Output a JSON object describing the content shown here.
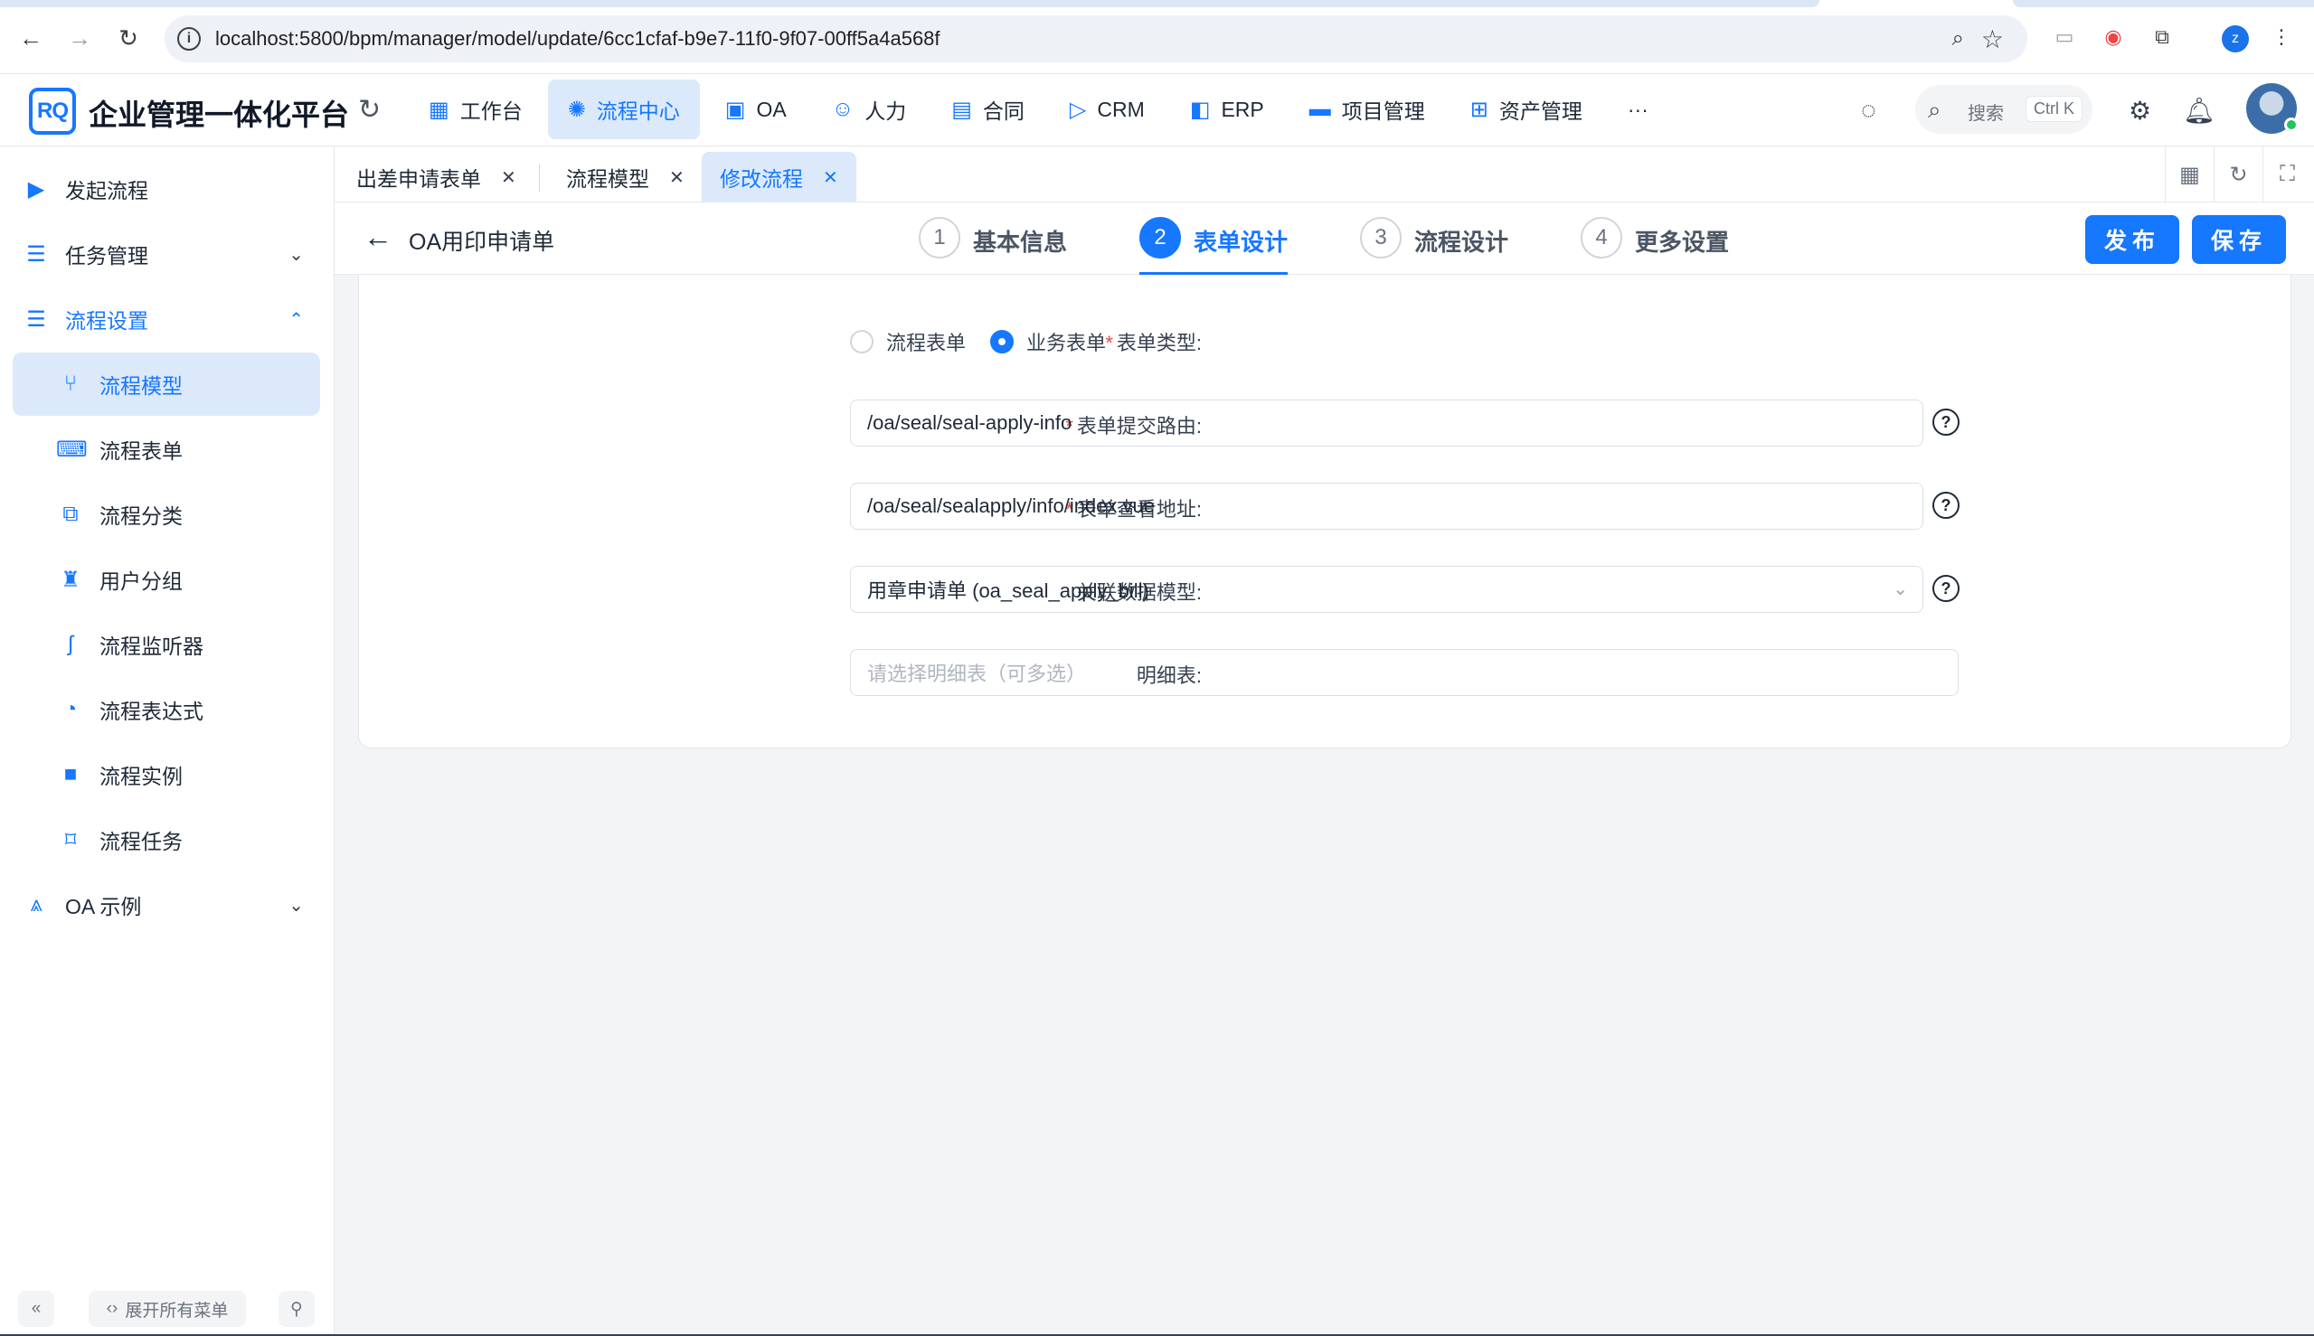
{
  "browser": {
    "url_host": "localhost",
    "url_rest": ":5800/bpm/manager/model/update/6cc1cfaf-b9e7-11f0-9f07-00ff5a4a568f",
    "profile_initial": "z"
  },
  "header": {
    "logo_text": "RQ",
    "app_title": "企业管理一体化平台",
    "menu": [
      {
        "label": "工作台",
        "icon": "dashboard-icon"
      },
      {
        "label": "流程中心",
        "icon": "workflow-icon",
        "active": true
      },
      {
        "label": "OA",
        "icon": "monitor-icon"
      },
      {
        "label": "人力",
        "icon": "person-icon"
      },
      {
        "label": "合同",
        "icon": "contract-icon"
      },
      {
        "label": "CRM",
        "icon": "crm-icon"
      },
      {
        "label": "ERP",
        "icon": "erp-icon"
      },
      {
        "label": "项目管理",
        "icon": "briefcase-icon"
      },
      {
        "label": "资产管理",
        "icon": "asset-icon"
      }
    ],
    "more": "···",
    "search_placeholder": "搜索",
    "search_shortcut": "Ctrl K"
  },
  "sidebar": {
    "items": [
      {
        "label": "发起流程",
        "icon": "play-icon"
      },
      {
        "label": "任务管理",
        "icon": "tasks-icon"
      },
      {
        "label": "流程设置",
        "icon": "settings-list-icon"
      },
      {
        "label": "流程模型",
        "icon": "model-icon"
      },
      {
        "label": "流程表单",
        "icon": "form-icon"
      },
      {
        "label": "流程分类",
        "icon": "category-icon"
      },
      {
        "label": "用户分组",
        "icon": "user-group-icon"
      },
      {
        "label": "流程监听器",
        "icon": "listener-icon"
      },
      {
        "label": "流程表达式",
        "icon": "expression-icon"
      },
      {
        "label": "流程实例",
        "icon": "instance-icon"
      },
      {
        "label": "流程任务",
        "icon": "bookmark-icon"
      },
      {
        "label": "OA 示例",
        "icon": "oa-icon"
      }
    ],
    "footer": {
      "collapse": "«",
      "expand_all": "展开所有菜单",
      "pin": "pin"
    }
  },
  "tabs": [
    {
      "label": "出差申请表单"
    },
    {
      "label": "流程模型"
    },
    {
      "label": "修改流程",
      "active": true
    }
  ],
  "editor": {
    "title": "OA用印申请单",
    "steps": [
      {
        "num": "1",
        "label": "基本信息"
      },
      {
        "num": "2",
        "label": "表单设计",
        "active": true
      },
      {
        "num": "3",
        "label": "流程设计"
      },
      {
        "num": "4",
        "label": "更多设置"
      }
    ],
    "publish_label": "发布",
    "save_label": "保存"
  },
  "form": {
    "type_label": "表单类型:",
    "type_options": [
      "流程表单",
      "业务表单"
    ],
    "type_selected": "业务表单",
    "submit_route_label": "表单提交路由:",
    "submit_route_value": "/oa/seal/seal-apply-info",
    "view_path_label": "表单查看地址:",
    "view_path_value": "/oa/seal/sealapply/info/index.vue",
    "data_model_label": "关联数据模型:",
    "data_model_value": "用章申请单 (oa_seal_apply_bill)",
    "detail_table_label": "明细表:",
    "detail_table_placeholder": "请选择明细表（可多选）"
  },
  "colors": {
    "primary": "#1677ff",
    "active_bg": "#dbe9fb",
    "required": "#ef4444"
  }
}
